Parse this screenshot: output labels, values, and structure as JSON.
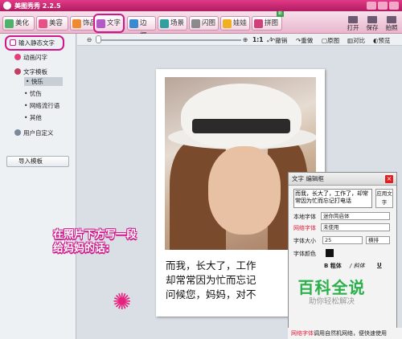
{
  "title_bar": {
    "title": "美图秀秀 2.2.5"
  },
  "toolbar": {
    "tabs": [
      {
        "label": "美化",
        "icon": "beautify-icon"
      },
      {
        "label": "美容",
        "icon": "cosmetic-icon"
      },
      {
        "label": "饰品",
        "icon": "accessory-icon"
      },
      {
        "label": "文字",
        "icon": "text-icon",
        "active": true
      },
      {
        "label": "边框",
        "icon": "frame-icon"
      },
      {
        "label": "场景",
        "icon": "scene-icon"
      },
      {
        "label": "闪图",
        "icon": "flash-icon"
      },
      {
        "label": "娃娃",
        "icon": "doll-icon"
      },
      {
        "label": "拼图",
        "icon": "collage-icon",
        "badge": "新"
      }
    ],
    "right": [
      "打开",
      "保存",
      "拍照"
    ]
  },
  "left_panel": {
    "input_static_text": "输入静态文字",
    "animated_text": "动画闪字",
    "text_template": "文字模板",
    "subitems": [
      "快乐",
      "忧伤",
      "网络流行语",
      "其他"
    ],
    "user_custom": "用户自定义",
    "import_template": "导入模板"
  },
  "canvas_bar": {
    "zoom": "1:1",
    "actions": [
      "撤销",
      "重做",
      "原图",
      "对比",
      "预览"
    ]
  },
  "photo_caption": {
    "line1": "而我，长大了，工作",
    "line2": "却常常因为忙而忘记",
    "line3": "问候您，妈妈，对不"
  },
  "annotation": {
    "line1": "在照片下方写一段",
    "line2": "给妈妈的话:"
  },
  "text_dialog": {
    "title": "文字 编辑框",
    "content": "而我，长大了，工作了，却常常因为忙而忘记打电话",
    "apply": "应用文字",
    "local_font_label": "本地字体",
    "local_font_value": "迷你简启体",
    "web_font_label": "网络字体",
    "web_font_value": "未使用",
    "font_size_label": "字体大小",
    "font_size_value": "25",
    "orientation_value": "横排",
    "font_color_label": "字体颜色",
    "bold": "粗体",
    "italic": "斜体",
    "underline": "U"
  },
  "status": {
    "red": "网络字体",
    "text": "调用自然机网络，便快速使用"
  },
  "watermark": {
    "big": "百科全说",
    "small": "助你轻松解决"
  },
  "colors": {
    "brand": "#e23a86",
    "highlight": "#d0168a",
    "font_color": "#111111"
  }
}
